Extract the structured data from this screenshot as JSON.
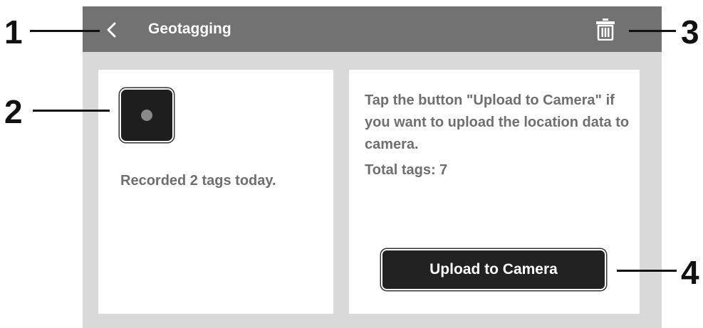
{
  "header": {
    "title": "Geotagging"
  },
  "left_panel": {
    "recorded_text": "Recorded 2 tags today."
  },
  "right_panel": {
    "info_text": "Tap the button \"Upload to Camera\" if you want to upload the location data to camera.",
    "total_tags": "Total tags: 7",
    "upload_button_label": "Upload to Camera"
  },
  "callouts": {
    "c1": "1",
    "c2": "2",
    "c3": "3",
    "c4": "4"
  },
  "icons": {
    "back": "chevron-left-icon",
    "delete": "trash-icon",
    "record": "record-icon"
  },
  "colors": {
    "titlebar": "#727272",
    "background": "#d9d9d9",
    "panel": "#ffffff",
    "button": "#222222",
    "text_muted": "#6f6f6f"
  }
}
